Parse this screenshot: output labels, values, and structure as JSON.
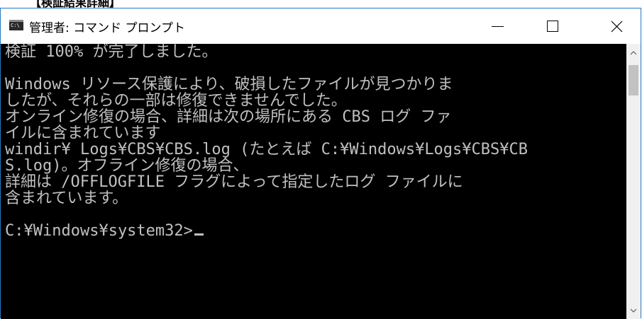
{
  "page_header_fragment": "【検証結果詳細】",
  "window": {
    "title": "管理者: コマンド プロンプト",
    "app_icon_glyph": "C:\\",
    "controls": {
      "minimize": "minimize",
      "maximize": "maximize",
      "close": "close"
    }
  },
  "console": {
    "background": "#000000",
    "text_color": "#c0c0c0",
    "lines": [
      "検証 100% が完了しました。",
      "",
      "Windows リソース保護により、破損したファイルが見つかりま",
      "したが、それらの一部は修復できませんでした。",
      "オンライン修復の場合、詳細は次の場所にある CBS ログ ファ",
      "イルに含まれています",
      "windir¥ Logs¥CBS¥CBS.log (たとえば C:¥Windows¥Logs¥CBS¥CB",
      "S.log)。オフライン修復の場合、",
      "詳細は /OFFLOGFILE フラグによって指定したログ ファイルに",
      "含まれています。",
      "",
      "C:¥Windows¥system32>"
    ]
  },
  "scrollbar": {
    "up_icon": "chevron-up-icon",
    "down_icon": "chevron-down-icon"
  }
}
